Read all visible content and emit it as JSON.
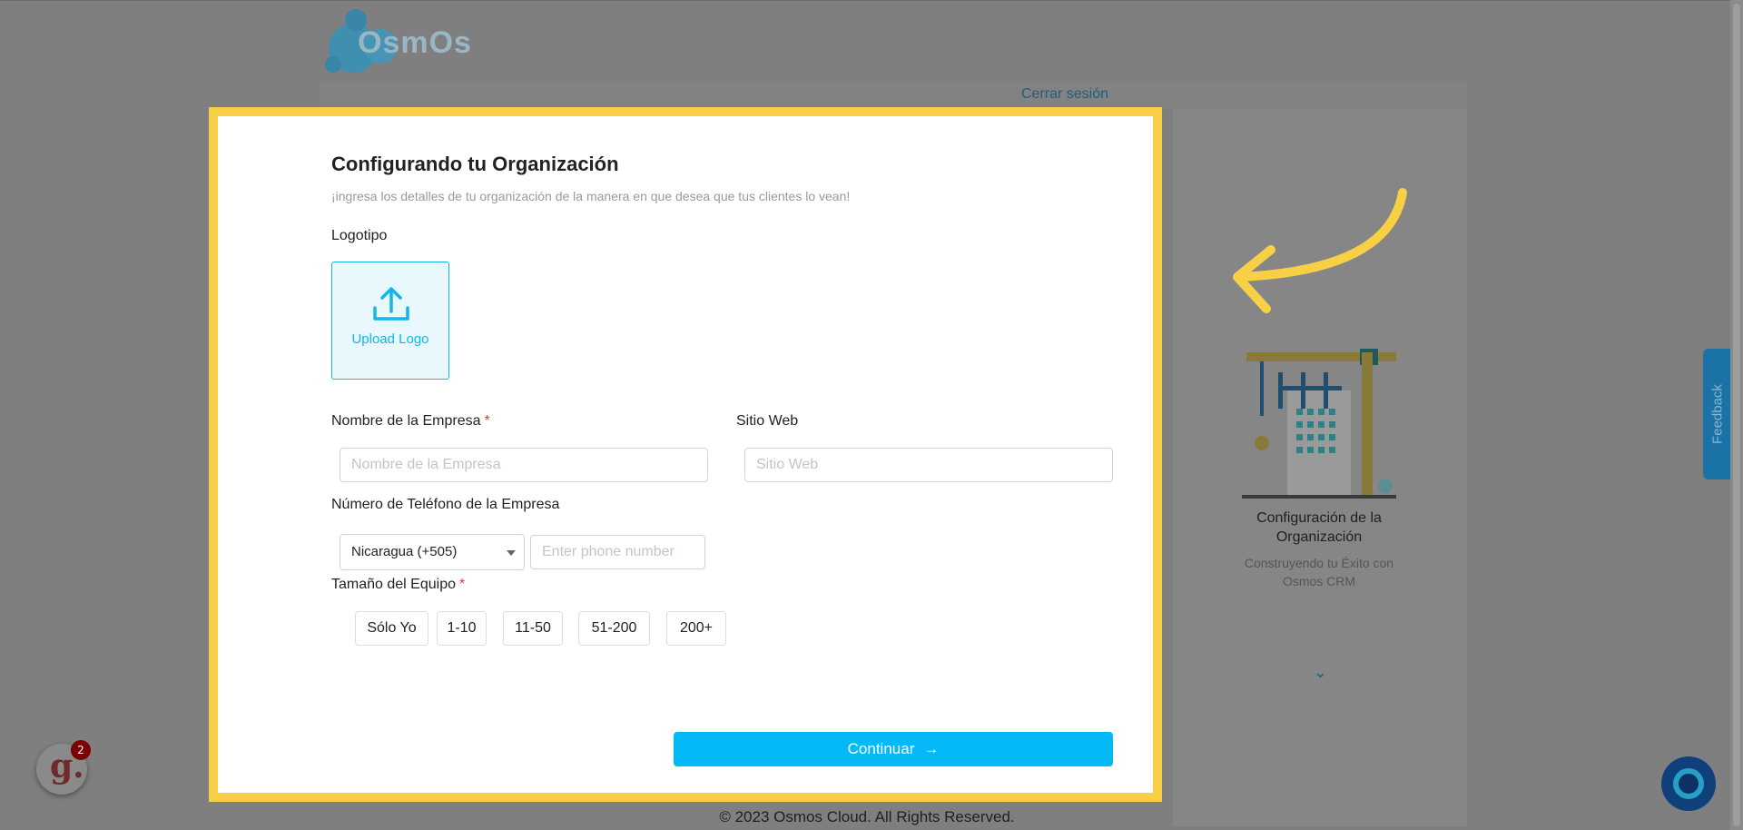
{
  "header": {
    "brand": "OsmOs",
    "logout_label": "Cerrar sesión"
  },
  "modal": {
    "title": "Configurando tu Organización",
    "subtitle": "¡ingresa los detalles de tu organización de la manera en que desea que tus clientes lo vean!",
    "logo_label": "Logotipo",
    "upload_label": "Upload Logo",
    "company_label": "Nombre de la Empresa",
    "company_placeholder": "Nombre de la Empresa",
    "website_label": "Sitio Web",
    "website_placeholder": "Sitio Web",
    "phone_label": "Número de Teléfono de la Empresa",
    "country_selected": "Nicaragua (+505)",
    "phone_placeholder": "Enter phone number",
    "team_label": "Tamaño del Equipo",
    "required_mark": "*",
    "team_options": [
      "Sólo Yo",
      "1-10",
      "11-50",
      "51-200",
      "200+"
    ],
    "continue_label": "Continuar"
  },
  "side_panel": {
    "title": "Configuración de la Organización",
    "subtitle": "Construyendo tu Éxito con Osmos CRM"
  },
  "widgets": {
    "feedback_label": "Feedback",
    "notification_count": "2",
    "g_letter": "g."
  },
  "footer": {
    "copyright": "© 2023 Osmos Cloud. All Rights Reserved."
  },
  "colors": {
    "accent": "#05b9f6",
    "highlight_border": "#f8d045",
    "overlay": "#7f7f7f"
  }
}
